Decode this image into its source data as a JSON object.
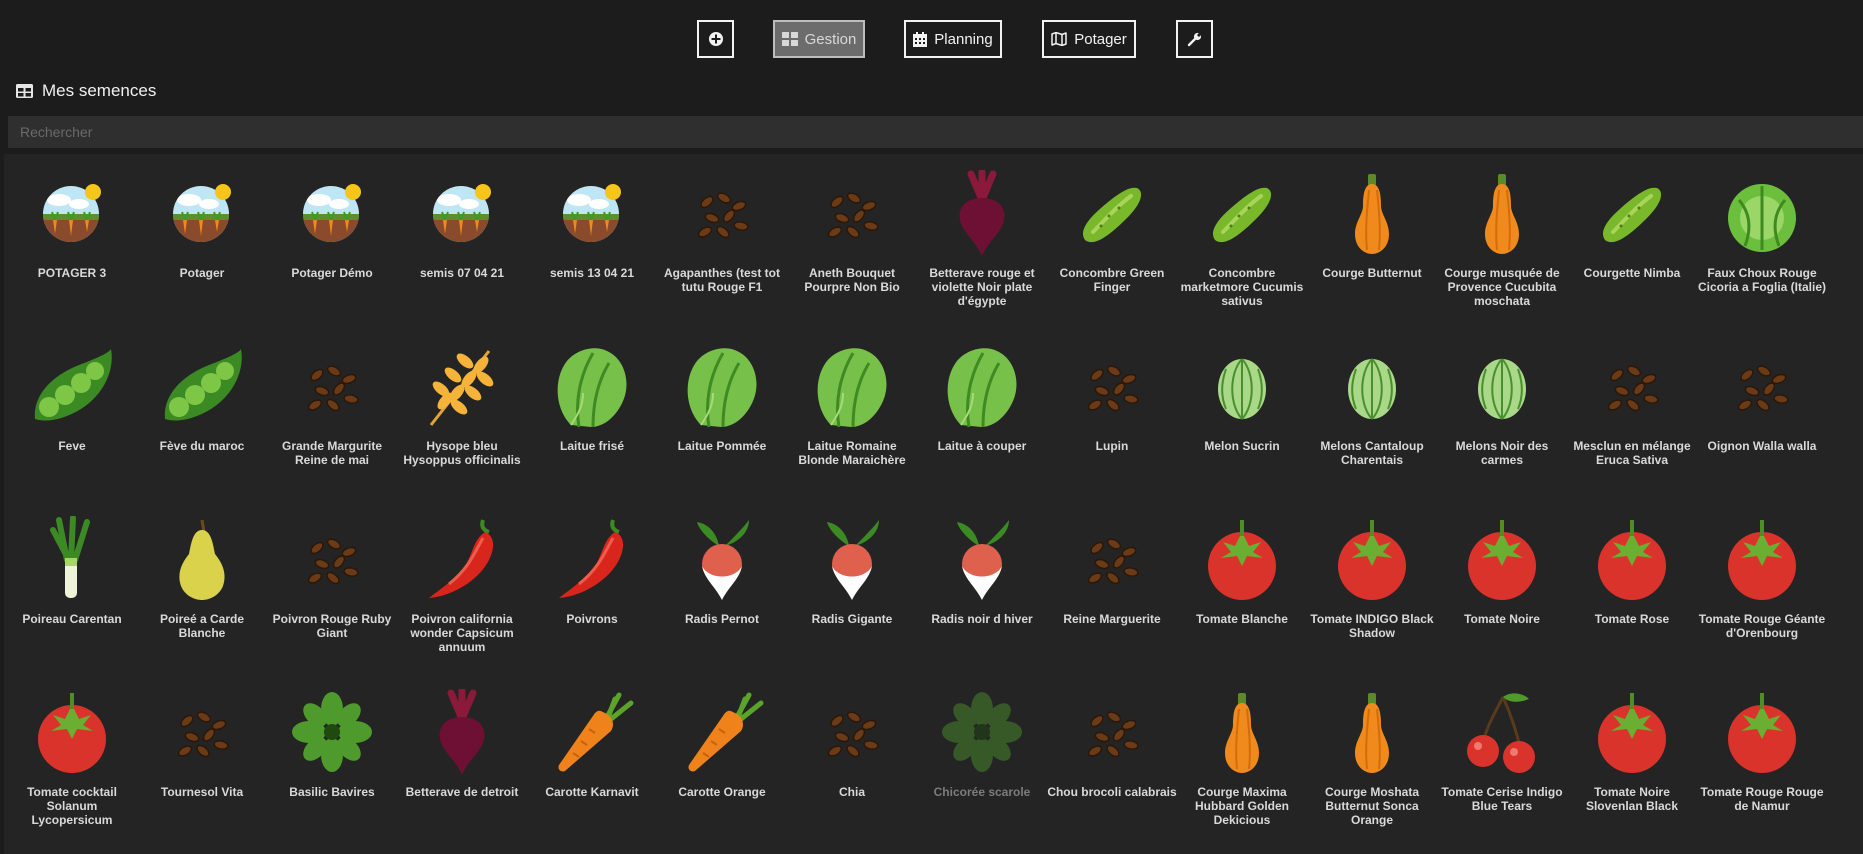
{
  "nav": {
    "add_icon": "plus-circle-icon",
    "gestion": {
      "label": "Gestion",
      "icon": "grid-icon"
    },
    "planning": {
      "label": "Planning",
      "icon": "calendar-icon"
    },
    "potager": {
      "label": "Potager",
      "icon": "map-icon"
    },
    "tools_icon": "wrench-icon"
  },
  "section": {
    "title": "Mes semences",
    "icon": "table-icon"
  },
  "search": {
    "placeholder": "Rechercher",
    "value": ""
  },
  "seeds": [
    {
      "label": "POTAGER 3",
      "icon": "garden"
    },
    {
      "label": "Potager",
      "icon": "garden"
    },
    {
      "label": "Potager Démo",
      "icon": "garden"
    },
    {
      "label": "semis 07 04 21",
      "icon": "garden"
    },
    {
      "label": "semis 13 04 21",
      "icon": "garden"
    },
    {
      "label": "Agapanthes (test tot tutu Rouge F1",
      "icon": "seeds"
    },
    {
      "label": "Aneth Bouquet Pourpre Non Bio",
      "icon": "seeds"
    },
    {
      "label": "Betterave rouge et violette Noir plate d'égypte",
      "icon": "beet"
    },
    {
      "label": "Concombre Green Finger",
      "icon": "cucumber"
    },
    {
      "label": "Concombre marketmore Cucumis sativus",
      "icon": "cucumber"
    },
    {
      "label": "Courge Butternut",
      "icon": "squash"
    },
    {
      "label": "Courge musquée de Provence Cucubita moschata",
      "icon": "squash"
    },
    {
      "label": "Courgette Nimba",
      "icon": "cucumber"
    },
    {
      "label": "Faux Choux Rouge Cicoria a Foglia (Italie)",
      "icon": "cabbage"
    },
    {
      "label": "Feve",
      "icon": "peas"
    },
    {
      "label": "Fève du maroc",
      "icon": "peas"
    },
    {
      "label": "Grande Margurite Reine de mai",
      "icon": "seeds"
    },
    {
      "label": "Hysope bleu Hysoppus officinalis",
      "icon": "wheat"
    },
    {
      "label": "Laitue frisé",
      "icon": "lettuce"
    },
    {
      "label": "Laitue Pommée",
      "icon": "lettuce"
    },
    {
      "label": "Laitue Romaine Blonde Maraichère",
      "icon": "lettuce"
    },
    {
      "label": "Laitue à couper",
      "icon": "lettuce"
    },
    {
      "label": "Lupin",
      "icon": "seeds"
    },
    {
      "label": "Melon Sucrin",
      "icon": "melon"
    },
    {
      "label": "Melons Cantaloup Charentais",
      "icon": "melon"
    },
    {
      "label": "Melons Noir des carmes",
      "icon": "melon"
    },
    {
      "label": "Mesclun en mélange Eruca Sativa",
      "icon": "seeds"
    },
    {
      "label": "Oignon Walla walla",
      "icon": "seeds"
    },
    {
      "label": "Poireau Carentan",
      "icon": "leek"
    },
    {
      "label": "Poireé a Carde Blanche",
      "icon": "pear"
    },
    {
      "label": "Poivron Rouge Ruby Giant",
      "icon": "seeds"
    },
    {
      "label": "Poivron california wonder Capsicum annuum",
      "icon": "pepper"
    },
    {
      "label": "Poivrons",
      "icon": "pepper"
    },
    {
      "label": "Radis Pernot",
      "icon": "radish"
    },
    {
      "label": "Radis Gigante",
      "icon": "radish"
    },
    {
      "label": "Radis noir d hiver",
      "icon": "radish"
    },
    {
      "label": "Reine Marguerite",
      "icon": "seeds"
    },
    {
      "label": "Tomate Blanche",
      "icon": "tomato"
    },
    {
      "label": "Tomate INDIGO Black Shadow",
      "icon": "tomato"
    },
    {
      "label": "Tomate Noire",
      "icon": "tomato"
    },
    {
      "label": "Tomate Rose",
      "icon": "tomato"
    },
    {
      "label": "Tomate Rouge Géante d'Orenbourg",
      "icon": "tomato"
    },
    {
      "label": "Tomate cocktail Solanum Lycopersicum",
      "icon": "tomato"
    },
    {
      "label": "Tournesol Vita",
      "icon": "seeds"
    },
    {
      "label": "Basilic Bavires",
      "icon": "basil"
    },
    {
      "label": "Betterave de detroit",
      "icon": "beet"
    },
    {
      "label": "Carotte Karnavit",
      "icon": "carrot"
    },
    {
      "label": "Carotte Orange",
      "icon": "carrot"
    },
    {
      "label": "Chia",
      "icon": "seeds"
    },
    {
      "label": "Chicorée scarole",
      "icon": "basil",
      "dim": true
    },
    {
      "label": "Chou brocoli calabrais",
      "icon": "seeds"
    },
    {
      "label": "Courge Maxima Hubbard Golden Dekicious",
      "icon": "squash"
    },
    {
      "label": "Courge Moshata Butternut Sonca Orange",
      "icon": "squash"
    },
    {
      "label": "Tomate Cerise Indigo Blue Tears",
      "icon": "cherries"
    },
    {
      "label": "Tomate Noire Slovenlan Black",
      "icon": "tomato"
    },
    {
      "label": "Tomate Rouge Rouge de Namur",
      "icon": "tomato"
    }
  ]
}
